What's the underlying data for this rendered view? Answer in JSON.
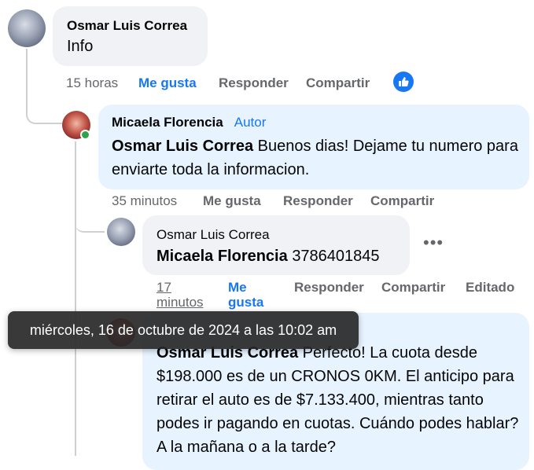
{
  "comments": [
    {
      "name": "Osmar Luis Correa",
      "text": "Info",
      "actions": {
        "time": "15 horas",
        "like": "Me gusta",
        "reply": "Responder",
        "share": "Compartir"
      }
    },
    {
      "name": "Micaela Florencia",
      "author_tag": "Autor",
      "mention": "Osmar Luis Correa",
      "text": "Buenos dias! Dejame tu numero para enviarte toda la informacion.",
      "actions": {
        "time": "35 minutos",
        "like": "Me gusta",
        "reply": "Responder",
        "share": "Compartir"
      }
    },
    {
      "name": "Osmar Luis Correa",
      "mention": "Micaela Florencia",
      "text": "3786401845",
      "actions": {
        "time_line1": "17",
        "time_line2": "minutos",
        "like_line1": "Me",
        "like_line2": "gusta",
        "reply": "Responder",
        "share": "Compartir",
        "edited": "Editado"
      }
    },
    {
      "mention": "Osmar Luis Correa",
      "text": "Perfecto! La cuota desde $198.000 es de un CRONOS 0KM. El anticipo para retirar el auto es de $7.133.400, mientras tanto podes ir pagando en cuotas. Cuándo podes hablar? A la mañana o a la tarde?"
    }
  ],
  "tooltip": "miércoles, 16 de octubre de 2024 a las 10:02 am",
  "icons": {
    "like_badge": "thumbs-up-icon",
    "more": "more-horizontal-icon"
  },
  "colors": {
    "accent": "#1877f2",
    "bubble": "#f0f2f5",
    "author_bubble": "#e7f3ff"
  }
}
